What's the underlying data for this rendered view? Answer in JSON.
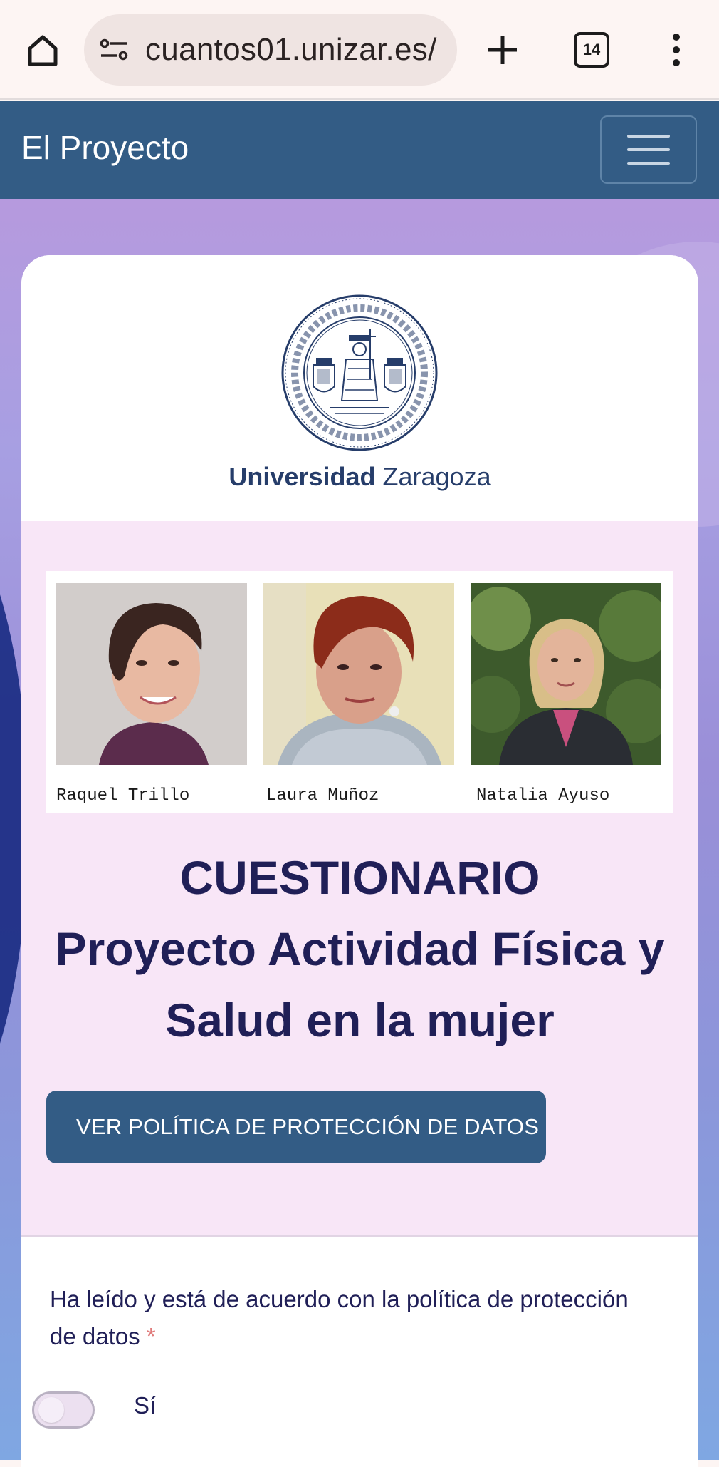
{
  "browser": {
    "url": "cuantos01.unizar.es/",
    "tab_count": "14"
  },
  "navbar": {
    "brand": "El Proyecto"
  },
  "logo": {
    "name_bold": "Universidad",
    "name_regular": "Zaragoza"
  },
  "team": {
    "members": [
      {
        "name": "Raquel Trillo"
      },
      {
        "name": "Laura Muñoz"
      },
      {
        "name": "Natalia Ayuso"
      }
    ]
  },
  "header": {
    "title_line1": "CUESTIONARIO",
    "title_line2": "Proyecto Actividad Física y",
    "title_line3": "Salud en la mujer",
    "policy_button": "VER POLÍTICA DE PROTECCIÓN DE DATOS"
  },
  "form": {
    "question": "Ha leído y está de acuerdo con la política de protección de datos",
    "required_mark": "*",
    "option_label": "Sí",
    "option_checked": false
  }
}
